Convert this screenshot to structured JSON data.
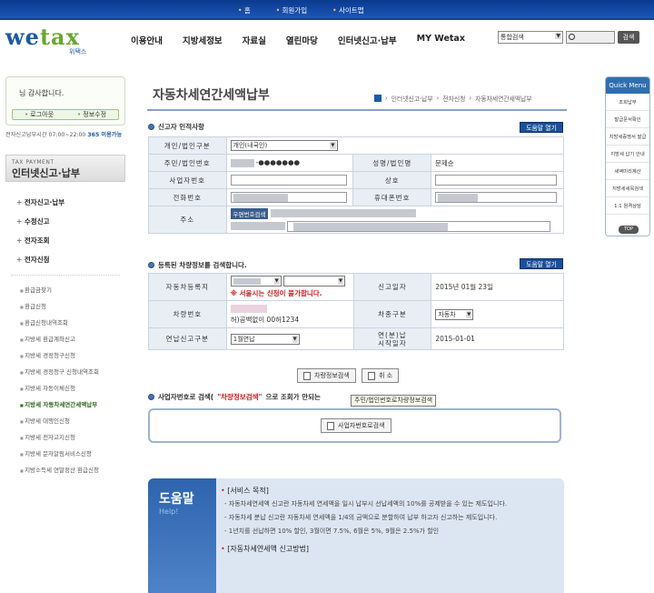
{
  "top_links": [
    "홈",
    "회원가입",
    "사이트맵"
  ],
  "logo": {
    "text_main": "we",
    "text_accent": "tax",
    "text_ko": "위택스"
  },
  "gnb": [
    "이용안내",
    "지방세정보",
    "자료실",
    "열린마당",
    "인터넷신고·납부",
    "MY Wetax"
  ],
  "search": {
    "select_value": "통합검색",
    "button": "검색"
  },
  "login": {
    "greeting": "님 감사합니다.",
    "logout": "로그아웃",
    "edit_info": "정보수정"
  },
  "hours": {
    "label": "전자신고납부시간 07:00~22:00",
    "suffix": "365 이용가능"
  },
  "side": {
    "head_en": "TAX PAYMENT",
    "head_ko": "인터넷신고·납부",
    "main_items": [
      "전자신고·납부",
      "수정신고",
      "전자조회",
      "전자신청"
    ],
    "sub_items": [
      "환급금찾기",
      "환급신청",
      "환급신청내역조회",
      "지방세 환급계좌신고",
      "지방세 경정청구신청",
      "지방세 경정청구 신청내역조회",
      "지방세 자동이체신청",
      "지방세 자동차세연간세액납부",
      "지방세 대행인신청",
      "지방세 전자고지신청",
      "지방세 문자알림서비스신청",
      "지방소득세 연말정산 환급신청"
    ],
    "active_index": 7
  },
  "quick": {
    "title": "Quick Menu",
    "items": [
      "조회납부",
      "발급문서확인",
      "지방세증명서 발급",
      "지방세 납기 안내",
      "세액미리계산",
      "지방세세목검색",
      "1:1 원격상담"
    ],
    "top": "TOP"
  },
  "page": {
    "title": "자동차세연간세액납부",
    "crumbs": [
      "인터넷신고·납부",
      "전자신청",
      "자동차세연간세액납부"
    ]
  },
  "section1": {
    "title": "신고자 인적사항",
    "help": "도움말 열기",
    "rows": {
      "type_label": "개인/법인구분",
      "type_value": "개인(내국인)",
      "id_label": "주민/법인번호",
      "id_value": "-●●●●●●●",
      "name_label": "성명/법인명",
      "name_value": "문제순",
      "biz_label": "사업자번호",
      "trade_label": "상호",
      "phone_label": "전화번호",
      "mobile_label": "휴대폰번호",
      "addr_label": "주소",
      "zip_button": "우편번호검색"
    }
  },
  "section2": {
    "title": "등록된 차량정보를 검색합니다.",
    "help": "도움말 열기",
    "rows": {
      "reg_label": "자동차등록지",
      "warn": "※ 서울시는 신청이 불가합니다.",
      "date_label": "신고일자",
      "date_value": "2015년 01월 23일",
      "car_label": "차량번호",
      "car_value": "허)공백없이 00허1234",
      "kind_label": "차종구분",
      "kind_value": "자동차",
      "annual_label": "연납신고구분",
      "annual_value": "1월연납",
      "start_label1": "연(분)납",
      "start_label2": "시작일자",
      "start_value": "2015-01-01"
    },
    "btn_search": "차량정보검색",
    "btn_cancel": "취 소"
  },
  "section3": {
    "title_pre": "사업자번호로 검색(",
    "title_red": "\"차량정보검색\"",
    "title_post": "으로 조회가 안되는",
    "tooltip": "주민/법인번호로차량정보검색",
    "btn": "사업자번호로검색"
  },
  "help_panel": {
    "tab_ko": "도움말",
    "tab_en": "Help!",
    "h1": "[서비스 목적]",
    "items": [
      "자동차세연세액 신고란 자동차세 연세액을 일시 납부시 선납세액의 10%를 공제받을 수 있는 제도입니다.",
      "자동차세 분납 신고란 자동차세 연세액을 1/4의 금액으로 분할하여 납부 하고자 신고하는 제도입니다.",
      "1년치를 선납하면 10% 할인, 3월이면 7.5%, 6월은 5%, 9월은 2.5%가 할인"
    ],
    "h2": "[자동차세연세액 신고방법]"
  }
}
